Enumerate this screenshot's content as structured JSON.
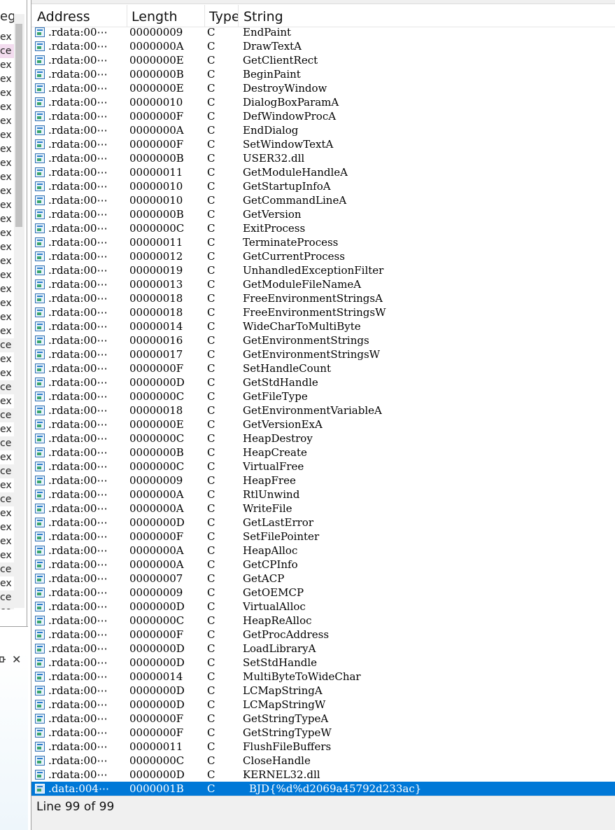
{
  "left_panel": {
    "header_fragment": "eg",
    "row_fragments": [
      "ex",
      "ce",
      "ex",
      "ex",
      "ex",
      "ex",
      "ex",
      "ex",
      "ex",
      "ex",
      "ex",
      "ex",
      "ex",
      "ex",
      "ex",
      "ex",
      "ex",
      "ex",
      "ex",
      "ex",
      "ex",
      "ex",
      "ce",
      "ex",
      "ex",
      "ce",
      "ex",
      "ce",
      "ex",
      "ce",
      "ex",
      "ce",
      "ex",
      "ce",
      "ex",
      "ex",
      "ex",
      "ex",
      "ce",
      "ex",
      "ce",
      "ce"
    ],
    "pin_icon": "pin-icon",
    "close_icon": "close-icon",
    "close_glyph": "✕"
  },
  "strings_window": {
    "columns": {
      "address": "Address",
      "length": "Length",
      "type": "Type",
      "string": "String"
    },
    "rows": [
      {
        "address": ".rdata:00⋯",
        "length": "00000009",
        "type": "C",
        "string": "EndPaint"
      },
      {
        "address": ".rdata:00⋯",
        "length": "0000000A",
        "type": "C",
        "string": "DrawTextA"
      },
      {
        "address": ".rdata:00⋯",
        "length": "0000000E",
        "type": "C",
        "string": "GetClientRect"
      },
      {
        "address": ".rdata:00⋯",
        "length": "0000000B",
        "type": "C",
        "string": "BeginPaint"
      },
      {
        "address": ".rdata:00⋯",
        "length": "0000000E",
        "type": "C",
        "string": "DestroyWindow"
      },
      {
        "address": ".rdata:00⋯",
        "length": "00000010",
        "type": "C",
        "string": "DialogBoxParamA"
      },
      {
        "address": ".rdata:00⋯",
        "length": "0000000F",
        "type": "C",
        "string": "DefWindowProcA"
      },
      {
        "address": ".rdata:00⋯",
        "length": "0000000A",
        "type": "C",
        "string": "EndDialog"
      },
      {
        "address": ".rdata:00⋯",
        "length": "0000000F",
        "type": "C",
        "string": "SetWindowTextA"
      },
      {
        "address": ".rdata:00⋯",
        "length": "0000000B",
        "type": "C",
        "string": "USER32.dll"
      },
      {
        "address": ".rdata:00⋯",
        "length": "00000011",
        "type": "C",
        "string": "GetModuleHandleA"
      },
      {
        "address": ".rdata:00⋯",
        "length": "00000010",
        "type": "C",
        "string": "GetStartupInfoA"
      },
      {
        "address": ".rdata:00⋯",
        "length": "00000010",
        "type": "C",
        "string": "GetCommandLineA"
      },
      {
        "address": ".rdata:00⋯",
        "length": "0000000B",
        "type": "C",
        "string": "GetVersion"
      },
      {
        "address": ".rdata:00⋯",
        "length": "0000000C",
        "type": "C",
        "string": "ExitProcess"
      },
      {
        "address": ".rdata:00⋯",
        "length": "00000011",
        "type": "C",
        "string": "TerminateProcess"
      },
      {
        "address": ".rdata:00⋯",
        "length": "00000012",
        "type": "C",
        "string": "GetCurrentProcess"
      },
      {
        "address": ".rdata:00⋯",
        "length": "00000019",
        "type": "C",
        "string": "UnhandledExceptionFilter"
      },
      {
        "address": ".rdata:00⋯",
        "length": "00000013",
        "type": "C",
        "string": "GetModuleFileNameA"
      },
      {
        "address": ".rdata:00⋯",
        "length": "00000018",
        "type": "C",
        "string": "FreeEnvironmentStringsA"
      },
      {
        "address": ".rdata:00⋯",
        "length": "00000018",
        "type": "C",
        "string": "FreeEnvironmentStringsW"
      },
      {
        "address": ".rdata:00⋯",
        "length": "00000014",
        "type": "C",
        "string": "WideCharToMultiByte"
      },
      {
        "address": ".rdata:00⋯",
        "length": "00000016",
        "type": "C",
        "string": "GetEnvironmentStrings"
      },
      {
        "address": ".rdata:00⋯",
        "length": "00000017",
        "type": "C",
        "string": "GetEnvironmentStringsW"
      },
      {
        "address": ".rdata:00⋯",
        "length": "0000000F",
        "type": "C",
        "string": "SetHandleCount"
      },
      {
        "address": ".rdata:00⋯",
        "length": "0000000D",
        "type": "C",
        "string": "GetStdHandle"
      },
      {
        "address": ".rdata:00⋯",
        "length": "0000000C",
        "type": "C",
        "string": "GetFileType"
      },
      {
        "address": ".rdata:00⋯",
        "length": "00000018",
        "type": "C",
        "string": "GetEnvironmentVariableA"
      },
      {
        "address": ".rdata:00⋯",
        "length": "0000000E",
        "type": "C",
        "string": "GetVersionExA"
      },
      {
        "address": ".rdata:00⋯",
        "length": "0000000C",
        "type": "C",
        "string": "HeapDestroy"
      },
      {
        "address": ".rdata:00⋯",
        "length": "0000000B",
        "type": "C",
        "string": "HeapCreate"
      },
      {
        "address": ".rdata:00⋯",
        "length": "0000000C",
        "type": "C",
        "string": "VirtualFree"
      },
      {
        "address": ".rdata:00⋯",
        "length": "00000009",
        "type": "C",
        "string": "HeapFree"
      },
      {
        "address": ".rdata:00⋯",
        "length": "0000000A",
        "type": "C",
        "string": "RtlUnwind"
      },
      {
        "address": ".rdata:00⋯",
        "length": "0000000A",
        "type": "C",
        "string": "WriteFile"
      },
      {
        "address": ".rdata:00⋯",
        "length": "0000000D",
        "type": "C",
        "string": "GetLastError"
      },
      {
        "address": ".rdata:00⋯",
        "length": "0000000F",
        "type": "C",
        "string": "SetFilePointer"
      },
      {
        "address": ".rdata:00⋯",
        "length": "0000000A",
        "type": "C",
        "string": "HeapAlloc"
      },
      {
        "address": ".rdata:00⋯",
        "length": "0000000A",
        "type": "C",
        "string": "GetCPInfo"
      },
      {
        "address": ".rdata:00⋯",
        "length": "00000007",
        "type": "C",
        "string": "GetACP"
      },
      {
        "address": ".rdata:00⋯",
        "length": "00000009",
        "type": "C",
        "string": "GetOEMCP"
      },
      {
        "address": ".rdata:00⋯",
        "length": "0000000D",
        "type": "C",
        "string": "VirtualAlloc"
      },
      {
        "address": ".rdata:00⋯",
        "length": "0000000C",
        "type": "C",
        "string": "HeapReAlloc"
      },
      {
        "address": ".rdata:00⋯",
        "length": "0000000F",
        "type": "C",
        "string": "GetProcAddress"
      },
      {
        "address": ".rdata:00⋯",
        "length": "0000000D",
        "type": "C",
        "string": "LoadLibraryA"
      },
      {
        "address": ".rdata:00⋯",
        "length": "0000000D",
        "type": "C",
        "string": "SetStdHandle"
      },
      {
        "address": ".rdata:00⋯",
        "length": "00000014",
        "type": "C",
        "string": "MultiByteToWideChar"
      },
      {
        "address": ".rdata:00⋯",
        "length": "0000000D",
        "type": "C",
        "string": "LCMapStringA"
      },
      {
        "address": ".rdata:00⋯",
        "length": "0000000D",
        "type": "C",
        "string": "LCMapStringW"
      },
      {
        "address": ".rdata:00⋯",
        "length": "0000000F",
        "type": "C",
        "string": "GetStringTypeA"
      },
      {
        "address": ".rdata:00⋯",
        "length": "0000000F",
        "type": "C",
        "string": "GetStringTypeW"
      },
      {
        "address": ".rdata:00⋯",
        "length": "00000011",
        "type": "C",
        "string": "FlushFileBuffers"
      },
      {
        "address": ".rdata:00⋯",
        "length": "0000000C",
        "type": "C",
        "string": "CloseHandle"
      },
      {
        "address": ".rdata:00⋯",
        "length": "0000000D",
        "type": "C",
        "string": "KERNEL32.dll"
      },
      {
        "address": ".data:004⋯",
        "length": "0000001B",
        "type": "C",
        "string": "BJD{%d%d2069a45792d233ac}",
        "selected": true
      }
    ],
    "row_icon": "string-item-icon",
    "status": "Line 99 of 99"
  },
  "colors": {
    "selection": "#0078d7",
    "status_bar": "#f0f0f0",
    "border": "#a0a0a0"
  }
}
